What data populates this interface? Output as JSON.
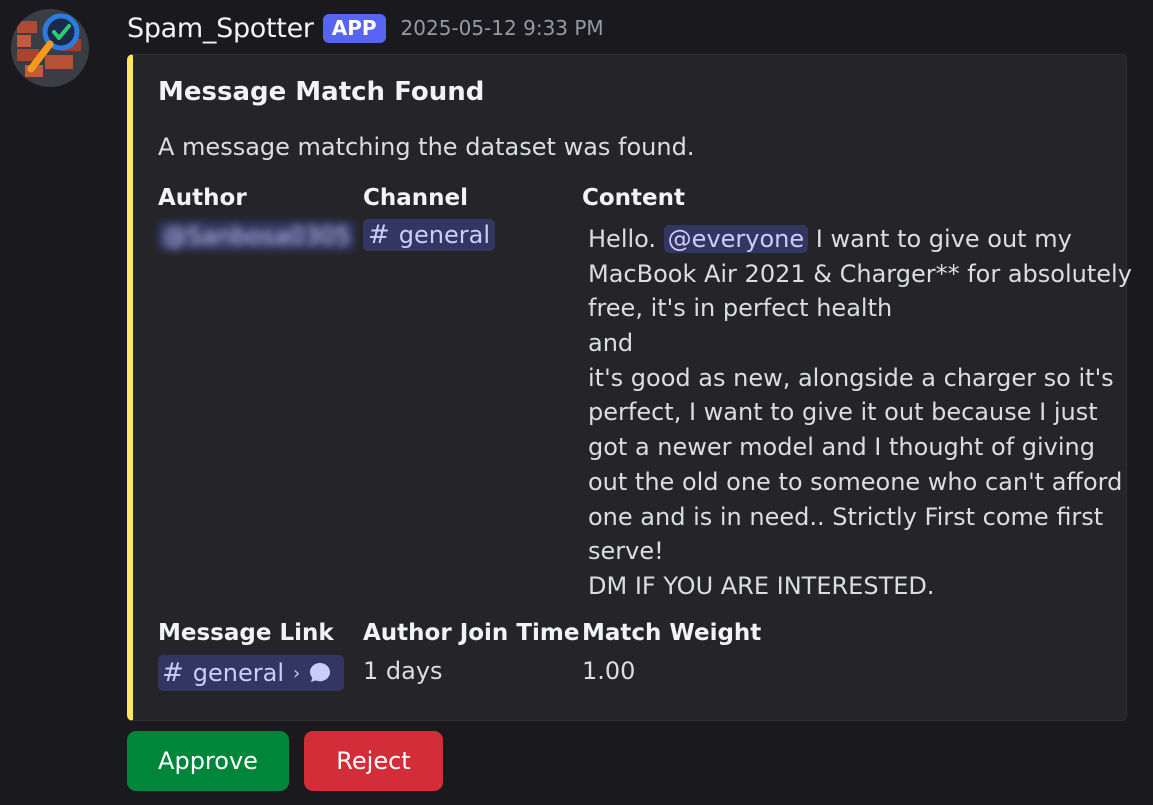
{
  "message": {
    "username": "Spam_Spotter",
    "badge": "APP",
    "timestamp": "2025-05-12 9:33 PM"
  },
  "embed": {
    "accent_color": "#fee75c",
    "title": "Message Match Found",
    "description": "A message matching the dataset was found.",
    "fields": {
      "author": {
        "name": "Author",
        "value": "@Sanbosa0305"
      },
      "channel": {
        "name": "Channel",
        "value": "general"
      },
      "content": {
        "name": "Content",
        "lines": [
          {
            "before": "Hello. ",
            "mention": "@everyone",
            "after": " I want to give out my"
          },
          "MacBook Air 2021 & Charger** for absolutely",
          "free, it's in perfect health",
          "and",
          "it's good as new, alongside a charger so it's",
          "perfect, I want to give it out because I just",
          "got a newer model and I thought of giving",
          "out the old one to someone who can't afford",
          "one and is in need.. Strictly First come first",
          "serve!",
          "DM IF YOU ARE INTERESTED."
        ]
      },
      "message_link": {
        "name": "Message Link",
        "value": "general"
      },
      "author_join_time": {
        "name": "Author Join Time",
        "value": "1 days"
      },
      "match_weight": {
        "name": "Match Weight",
        "value": "1.00"
      }
    }
  },
  "buttons": {
    "approve": "Approve",
    "reject": "Reject"
  },
  "colors": {
    "background": "#1a1a1e",
    "embed_background": "#242429",
    "app_badge": "#5865f2",
    "mention": "#323660",
    "approve": "#00863a",
    "reject": "#d22d39"
  },
  "icons": {
    "avatar": "magnifier-check-avatar-icon",
    "channel": "hash-icon",
    "link_chevron": "chevron-right-icon",
    "link_thread": "speech-bubble-icon"
  }
}
